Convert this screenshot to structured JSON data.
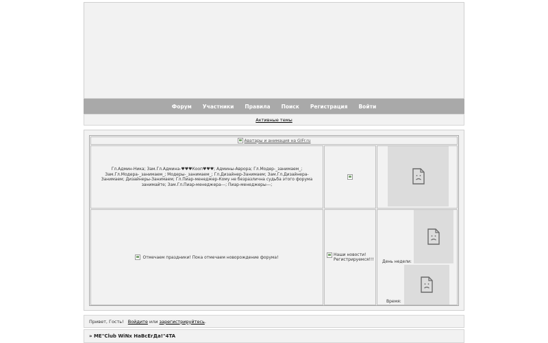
{
  "nav": {
    "items": [
      {
        "label": "Форум"
      },
      {
        "label": "Участники"
      },
      {
        "label": "Правила"
      },
      {
        "label": "Поиск"
      },
      {
        "label": "Регистрация"
      },
      {
        "label": "Войти"
      }
    ]
  },
  "subnav": {
    "active_topics": "Активные темы"
  },
  "banner": {
    "alt_text": "Аватары и анимация на GIFr.ru"
  },
  "admins": {
    "text": "Гл.Админ-Ника; Зам.Гл.Админа-♥♥♥Кооп♥♥♥; Админы-Аврора; Гл.Модер-_занимаем_; Зам.Гл.Модера-_занимаем_; Модеры-_занимаем_; Гл.Дизайнер-Занимаем; Зам.Гл.Дизайнера-Занимаем; Дизайнеры-Занимаем; Гл.Пиар-менеджер-Кому не безразлична судьба этого форума занимайте; Зам.Гл.Пиар-менеджера---; Пиар-менеджеры---;"
  },
  "holiday": {
    "alt_text": "Отмечаем праздники! Пока отмечаем новорождение форума!"
  },
  "news": {
    "alt_text": "Наши новости! Регистрируемся!!!"
  },
  "week": {
    "day_label": "День недели:",
    "time_label": "Время:"
  },
  "greeting": {
    "prefix": "Привет, Гость!",
    "login_link": "Войдите",
    "or_text": "или",
    "register_link": "зарегистрируйтесь",
    "suffix": "."
  },
  "forum": {
    "title": "» ME\"Club WiNx HaBcEгДа!\"4TA"
  }
}
